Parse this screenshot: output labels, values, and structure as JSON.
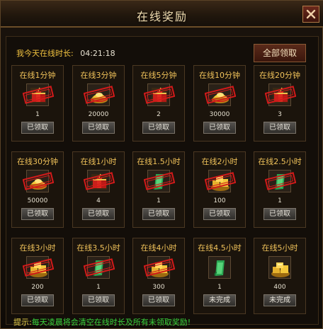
{
  "window": {
    "title": "在线奖励",
    "close_icon": "close-icon"
  },
  "online_time": {
    "label": "我今天在线时长:",
    "value": "04:21:18"
  },
  "claim_all_label": "全部领取",
  "rewards": [
    {
      "label": "在线1分钟",
      "qty": "1",
      "status": "已领取",
      "icon": "firecracker-icon",
      "stamped": true
    },
    {
      "label": "在线3分钟",
      "qty": "20000",
      "status": "已领取",
      "icon": "gold-ingot-icon",
      "stamped": true
    },
    {
      "label": "在线5分钟",
      "qty": "2",
      "status": "已领取",
      "icon": "firecracker-icon",
      "stamped": true
    },
    {
      "label": "在线10分钟",
      "qty": "30000",
      "status": "已领取",
      "icon": "gold-ingot-icon",
      "stamped": true
    },
    {
      "label": "在线20分钟",
      "qty": "3",
      "status": "已领取",
      "icon": "firecracker-icon",
      "stamped": true
    },
    {
      "label": "在线30分钟",
      "qty": "50000",
      "status": "已领取",
      "icon": "gold-ingot-icon",
      "stamped": true
    },
    {
      "label": "在线1小时",
      "qty": "4",
      "status": "已领取",
      "icon": "firecracker-icon",
      "stamped": true
    },
    {
      "label": "在线1.5小时",
      "qty": "1",
      "status": "已领取",
      "icon": "jade-scroll-icon",
      "stamped": true
    },
    {
      "label": "在线2小时",
      "qty": "100",
      "status": "已领取",
      "icon": "gold-pile-icon",
      "stamped": true
    },
    {
      "label": "在线2.5小时",
      "qty": "1",
      "status": "已领取",
      "icon": "jade-scroll-icon",
      "stamped": true
    },
    {
      "label": "在线3小时",
      "qty": "200",
      "status": "已领取",
      "icon": "gold-pile-icon",
      "stamped": true
    },
    {
      "label": "在线3.5小时",
      "qty": "1",
      "status": "已领取",
      "icon": "jade-scroll-icon",
      "stamped": true
    },
    {
      "label": "在线4小时",
      "qty": "300",
      "status": "已领取",
      "icon": "gold-pile-icon",
      "stamped": true
    },
    {
      "label": "在线4.5小时",
      "qty": "1",
      "status": "未完成",
      "icon": "jade-scroll-icon",
      "stamped": false
    },
    {
      "label": "在线5小时",
      "qty": "400",
      "status": "未完成",
      "icon": "gold-pile-icon",
      "stamped": false
    }
  ],
  "footer": {
    "prefix": "提示:",
    "text": "每天凌晨将会清空在线时长及所有未领取奖励!"
  },
  "colors": {
    "label_gold": "#f0c25a",
    "tip_green": "#39d23c",
    "stamp_red": "#d21a1a"
  }
}
